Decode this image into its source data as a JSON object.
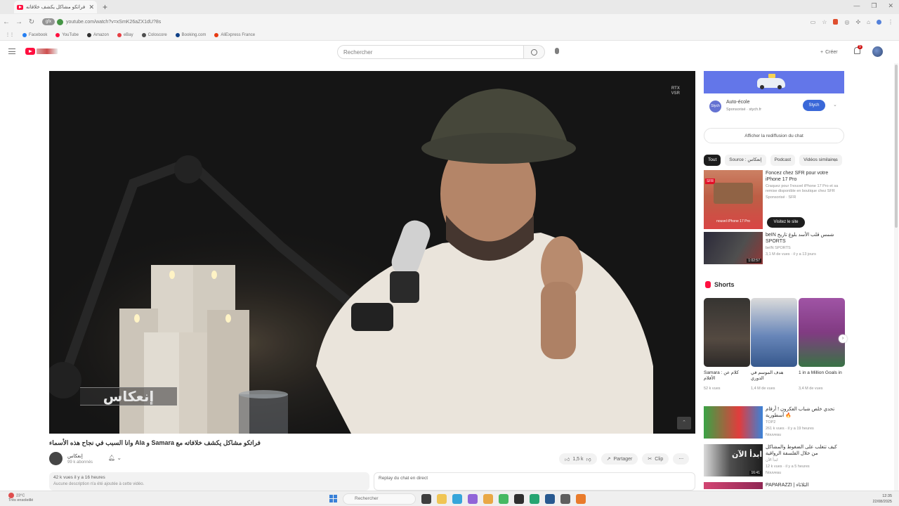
{
  "browser": {
    "tab_title": "فراتكو مشاكل يكشف خلافاته",
    "tab_close": "✕",
    "new_tab": "+",
    "url": "youtube.com/watch?v=xSmK26aZX1dU?8s",
    "gfx_label": "gfx",
    "window_controls": [
      "—",
      "❐",
      "✕"
    ],
    "bookmarks": [
      {
        "label": "Facebook",
        "color": "#1877f2"
      },
      {
        "label": "YouTube",
        "color": "#ff0033"
      },
      {
        "label": "Amazon",
        "color": "#222222"
      },
      {
        "label": "eBay",
        "color": "#e53238"
      },
      {
        "label": "Coloscore",
        "color": "#444444"
      },
      {
        "label": "Booking.com",
        "color": "#003580"
      },
      {
        "label": "AliExpress France",
        "color": "#e62e04"
      }
    ]
  },
  "header": {
    "search_placeholder": "Rechercher",
    "create_label": "Créer",
    "notif_count": "9"
  },
  "player": {
    "badge_line1": "RTX",
    "badge_line2": "VSR",
    "watermark_text": "إنعكاس",
    "corner_btn": "⌃"
  },
  "video": {
    "title": "وانا السبب في نجاح هذه الأسماء Ala و Samara فراتكو مشاكل يكشف خلافاته مع",
    "channel_name": "إنعكاس",
    "channel_subs": "99 k abonnés",
    "likes": "1,5 k",
    "share_label": "Partager",
    "clip_label": "Clip",
    "more_label": "⋯",
    "views_time": "42 k vues  il y a 16 heures",
    "description": "Aucune description n'a été ajoutée à cette vidéo.",
    "chat_replay_title": "Replay du chat en direct"
  },
  "sidebar": {
    "ad": {
      "title": "Auto-école",
      "sponsor": "Sponsorisé · stych.fr",
      "button": "Stych",
      "logo_text": "Stych"
    },
    "chat_replay_button": "Afficher la rediffusion du chat",
    "chips": [
      "Tout",
      "Source : إنعكاس",
      "Podcast",
      "Vidéos similaires"
    ],
    "sfr": {
      "title": "Foncez chez SFR pour votre iPhone 17 Pro",
      "desc": "Craquez pour l'nouvel iPhone 17 Pro et sa remise disponible en boutique chez SFR",
      "sponsor": "Sponsorisé · SFR",
      "cta": "Visitez le site",
      "tag": "SFR",
      "thumb_caption": "nouvel iPhone 17 Pro"
    },
    "bein": {
      "title": "beIN شمس قلب الأسد بلوغ تاريخ SPORTS",
      "channel": "beIN SPORTS",
      "meta": "3,1 M de vues · il y a 13 jours",
      "duration": "1:02:57"
    },
    "shorts_title": "Shorts",
    "shorts": [
      {
        "caption": "Samara : كلام عن الأفلام",
        "views": "52 k vues"
      },
      {
        "caption": "هدف الموسم في الدوري",
        "views": "1,4 M de vues"
      },
      {
        "caption": "1 in a Million Goals in",
        "views": "3,4 M de vues"
      }
    ],
    "recs": [
      {
        "title": "تحدي خلص شباب الفكرون ! أرقام أسطورية 🔥",
        "channel": "TOP2",
        "meta": "261 k vues · il y a 19 heures",
        "badge": "Nouveau"
      },
      {
        "title": "كيف تتغلب على الضغوط والمشاكل من خلال الفلسفة الرواقية",
        "channel": "ابدأ الآن",
        "meta": "12 k vues · il y a 5 heures",
        "badge": "Nouveau",
        "duration": "16:41",
        "thumb_text": "ابدأ الآن"
      },
      {
        "title": "PAPARAZZI | الثلاثاء",
        "channel": "",
        "meta": "",
        "badge": ""
      }
    ]
  },
  "taskbar": {
    "weather_temp": "23°C",
    "weather_desc": "Très ensoleillé",
    "search_label": "Rechercher",
    "time": "12:35",
    "date": "22/08/2025"
  }
}
